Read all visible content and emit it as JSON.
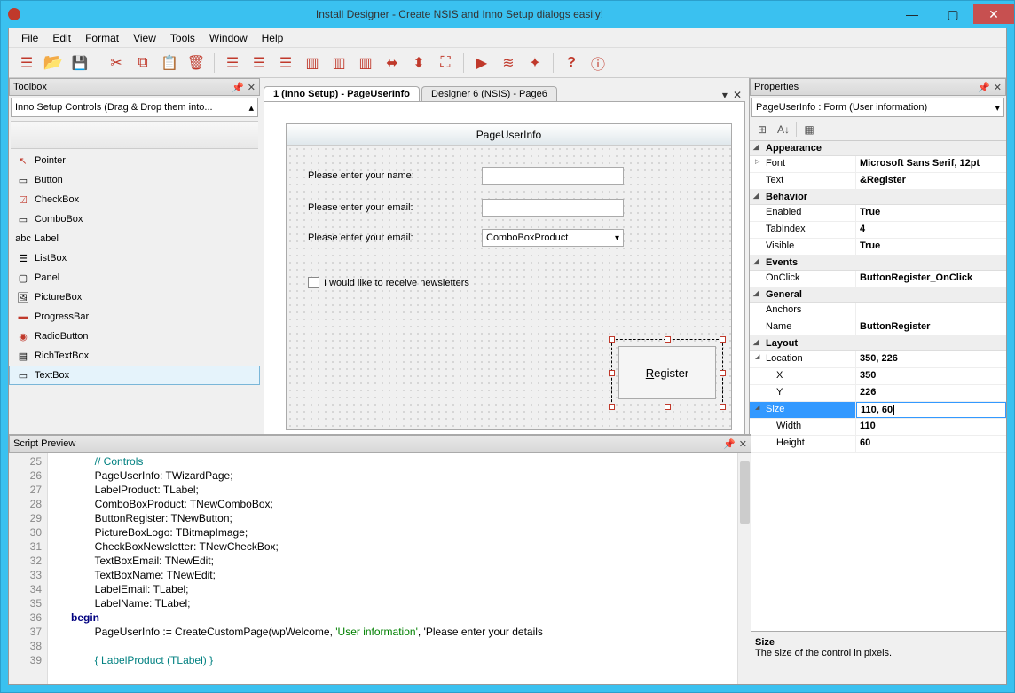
{
  "title": "Install Designer - Create NSIS and Inno Setup dialogs easily!",
  "menu": [
    "File",
    "Edit",
    "Format",
    "View",
    "Tools",
    "Window",
    "Help"
  ],
  "toolbox": {
    "title": "Toolbox",
    "dropdown": "Inno Setup Controls (Drag & Drop them into...",
    "items": [
      "Pointer",
      "Button",
      "CheckBox",
      "ComboBox",
      "Label",
      "ListBox",
      "Panel",
      "PictureBox",
      "ProgressBar",
      "RadioButton",
      "RichTextBox",
      "TextBox"
    ],
    "selected": "TextBox"
  },
  "tabs": {
    "active": "1 (Inno Setup) - PageUserInfo",
    "inactive": "Designer 6 (NSIS) - Page6"
  },
  "form": {
    "title": "PageUserInfo",
    "label_name": "Please enter your name:",
    "label_email": "Please enter your email:",
    "label_product": "Please enter your email:",
    "combo_value": "ComboBoxProduct",
    "checkbox_label": "I would like to receive newsletters",
    "register_label": "Register"
  },
  "script": {
    "title": "Script Preview",
    "lines": [
      {
        "n": 25,
        "t": "        // Controls",
        "cls": "cm"
      },
      {
        "n": 26,
        "t": "        PageUserInfo: TWizardPage;"
      },
      {
        "n": 27,
        "t": "        LabelProduct: TLabel;"
      },
      {
        "n": 28,
        "t": "        ComboBoxProduct: TNewComboBox;"
      },
      {
        "n": 29,
        "t": "        ButtonRegister: TNewButton;"
      },
      {
        "n": 30,
        "t": "        PictureBoxLogo: TBitmapImage;"
      },
      {
        "n": 31,
        "t": "        CheckBoxNewsletter: TNewCheckBox;"
      },
      {
        "n": 32,
        "t": "        TextBoxEmail: TNewEdit;"
      },
      {
        "n": 33,
        "t": "        TextBoxName: TNewEdit;"
      },
      {
        "n": 34,
        "t": "        LabelEmail: TLabel;"
      },
      {
        "n": 35,
        "t": "        LabelName: TLabel;"
      },
      {
        "n": 36,
        "t": "begin",
        "cls": "kw"
      },
      {
        "n": 37,
        "t": "        PageUserInfo := CreateCustomPage(wpWelcome, 'User information', 'Please enter your details"
      },
      {
        "n": 38,
        "t": ""
      },
      {
        "n": 39,
        "t": "        { LabelProduct (TLabel) }",
        "cls": "cm"
      }
    ]
  },
  "properties": {
    "title": "Properties",
    "selector": "PageUserInfo : Form (User information)",
    "groups": [
      {
        "cat": "Appearance",
        "rows": [
          {
            "name": "Font",
            "val": "Microsoft Sans Serif, 12pt",
            "exp": "p"
          },
          {
            "name": "Text",
            "val": "&Register"
          }
        ]
      },
      {
        "cat": "Behavior",
        "rows": [
          {
            "name": "Enabled",
            "val": "True"
          },
          {
            "name": "TabIndex",
            "val": "4"
          },
          {
            "name": "Visible",
            "val": "True"
          }
        ]
      },
      {
        "cat": "Events",
        "rows": [
          {
            "name": "OnClick",
            "val": "ButtonRegister_OnClick"
          }
        ]
      },
      {
        "cat": "General",
        "rows": [
          {
            "name": "Anchors",
            "val": ""
          },
          {
            "name": "Name",
            "val": "ButtonRegister"
          }
        ]
      },
      {
        "cat": "Layout",
        "rows": [
          {
            "name": "Location",
            "val": "350, 226",
            "exp": "y"
          },
          {
            "name": "X",
            "val": "350",
            "sub": true
          },
          {
            "name": "Y",
            "val": "226",
            "sub": true
          },
          {
            "name": "Size",
            "val": "110, 60",
            "exp": "y",
            "selected": true
          },
          {
            "name": "Width",
            "val": "110",
            "sub": true
          },
          {
            "name": "Height",
            "val": "60",
            "sub": true
          }
        ]
      }
    ],
    "desc_title": "Size",
    "desc_text": "The size of the control in pixels."
  }
}
